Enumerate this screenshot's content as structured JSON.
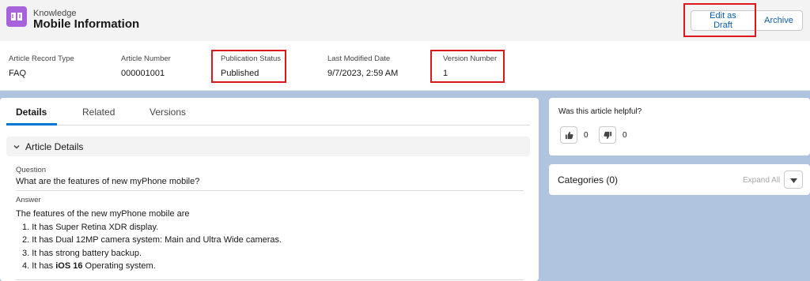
{
  "header": {
    "object_label": "Knowledge",
    "title": "Mobile Information",
    "icon": "knowledge-book-icon",
    "edit_draft_label": "Edit as Draft",
    "archive_label": "Archive"
  },
  "highlights": [
    {
      "label": "Article Record Type",
      "value": "FAQ"
    },
    {
      "label": "Article Number",
      "value": "000001001"
    },
    {
      "label": "Publication Status",
      "value": "Published"
    },
    {
      "label": "Last Modified Date",
      "value": "9/7/2023, 2:59 AM"
    },
    {
      "label": "Version Number",
      "value": "1"
    }
  ],
  "tabs": [
    {
      "label": "Details",
      "active": true
    },
    {
      "label": "Related",
      "active": false
    },
    {
      "label": "Versions",
      "active": false
    }
  ],
  "section": {
    "title": "Article Details",
    "question_label": "Question",
    "question_value": "What are the features of new myPhone mobile?",
    "answer_label": "Answer",
    "answer_intro": "The features of the new myPhone mobile are",
    "answer_items": [
      "1. It has Super Retina XDR display.",
      "2. It has Dual 12MP camera system: Main and Ultra Wide cameras.",
      "3. It has strong battery backup."
    ],
    "answer_item4_prefix": "4. It has ",
    "answer_item4_bold": "iOS 16",
    "answer_item4_suffix": " Operating system."
  },
  "feedback": {
    "question": "Was this article helpful?",
    "likes": "0",
    "dislikes": "0"
  },
  "categories": {
    "title": "Categories (0)",
    "expand_all": "Expand All"
  },
  "colors": {
    "brand_blue": "#0176d3",
    "highlight_red": "#e0161f",
    "icon_purple": "#a763dc",
    "page_bg": "#b0c4df"
  }
}
